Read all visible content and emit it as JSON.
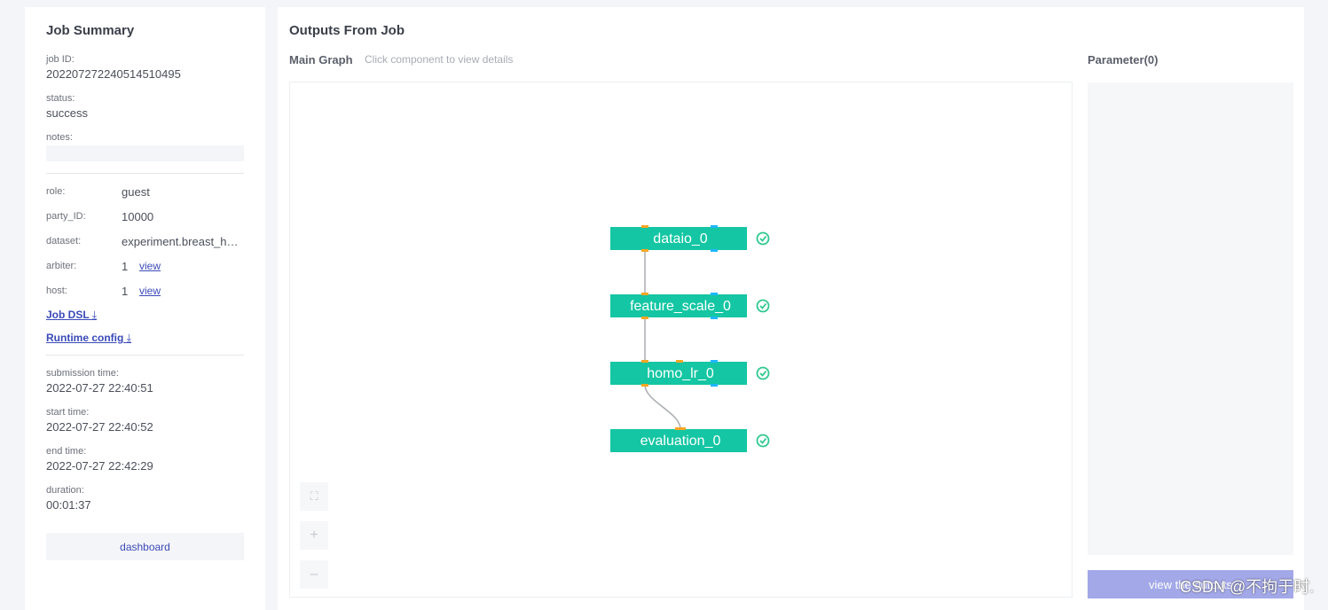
{
  "summary": {
    "title": "Job Summary",
    "job_id_label": "job  ID:",
    "job_id": "202207272240514510495",
    "status_label": "status:",
    "status": "success",
    "notes_label": "notes:",
    "role_label": "role:",
    "role": "guest",
    "party_label": "party_ID:",
    "party_id": "10000",
    "dataset_label": "dataset:",
    "dataset": "experiment.breast_homo_guest",
    "arbiter_label": "arbiter:",
    "arbiter_count": "1",
    "host_label": "host:",
    "host_count": "1",
    "view_link": "view",
    "job_dsl": "Job DSL",
    "runtime_config": "Runtime config",
    "download_glyph": "⤓",
    "submission_label": "submission  time:",
    "submission_time": "2022-07-27 22:40:51",
    "start_label": "start  time:",
    "start_time": "2022-07-27 22:40:52",
    "end_label": "end  time:",
    "end_time": "2022-07-27 22:42:29",
    "duration_label": "duration:",
    "duration": "00:01:37",
    "dashboard": "dashboard"
  },
  "outputs": {
    "title": "Outputs From Job",
    "main_graph": "Main Graph",
    "hint": "Click component to view details",
    "parameter": "Parameter(0)",
    "view_button": "view the outputs",
    "tools": {
      "fit": "⛶",
      "zoom_in": "+",
      "zoom_out": "–"
    }
  },
  "graph": {
    "node_color": "#14c6a3",
    "success_color": "#2ec98f",
    "port_orange": "#f5a623",
    "port_blue": "#1fb6ff",
    "nodes": [
      {
        "id": "dataio_0",
        "label": "dataio_0",
        "status": "success"
      },
      {
        "id": "feature_scale_0",
        "label": "feature_scale_0",
        "status": "success"
      },
      {
        "id": "homo_lr_0",
        "label": "homo_lr_0",
        "status": "success"
      },
      {
        "id": "evaluation_0",
        "label": "evaluation_0",
        "status": "success"
      }
    ]
  },
  "watermark": "CSDN @不拘于时."
}
